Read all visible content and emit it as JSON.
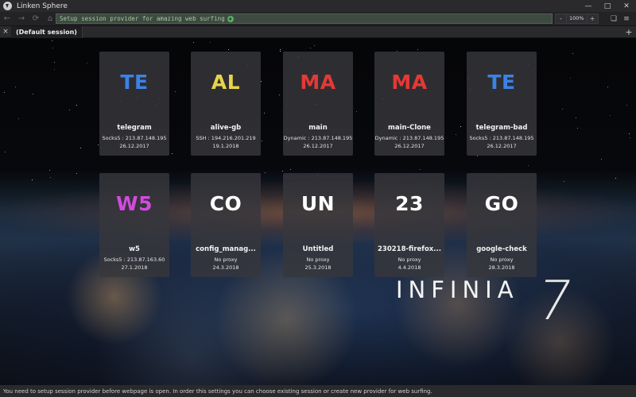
{
  "window": {
    "title": "Linken Sphere",
    "icon": "linken-sphere-logo-icon",
    "controls": [
      "minimize-icon",
      "maximize-icon",
      "close-icon"
    ]
  },
  "toolbar": {
    "back_icon": "arrow-left-icon",
    "forward_icon": "arrow-right-icon",
    "reload_icon": "reload-icon",
    "home_icon": "home-icon",
    "address_text": "Setup session provider for amazing web surfing",
    "address_plus": "+",
    "zoom": {
      "minus": "-",
      "value": "100%",
      "plus": "+"
    },
    "right_icons": [
      "bookmark-icon",
      "menu-icon"
    ]
  },
  "tabs": {
    "close_label": "×",
    "items": [
      {
        "label": "(Default session)"
      }
    ],
    "new_tab_label": "+"
  },
  "sessions": [
    {
      "abbr": "TE",
      "color": "#3b82e6",
      "name": "telegram",
      "proxy": "Socks5 : 213.87.148.195",
      "date": "26.12.2017"
    },
    {
      "abbr": "AL",
      "color": "#e7d44a",
      "name": "alive-gb",
      "proxy": "SSH : 194.216.201.219",
      "date": "19.1.2018"
    },
    {
      "abbr": "MA",
      "color": "#e53935",
      "name": "main",
      "proxy": "Dynamic : 213.87.148.195",
      "date": "26.12.2017"
    },
    {
      "abbr": "MA",
      "color": "#e53935",
      "name": "main-Clone",
      "proxy": "Dynamic : 213.87.148.195",
      "date": "26.12.2017"
    },
    {
      "abbr": "TE",
      "color": "#3b82e6",
      "name": "telegram-bad",
      "proxy": "Socks5 : 213.87.148.195",
      "date": "26.12.2017"
    },
    {
      "abbr": "W5",
      "color": "#d24ae0",
      "name": "w5",
      "proxy": "Socks5 : 213.87.163.60",
      "date": "27.1.2018"
    },
    {
      "abbr": "CO",
      "color": "#ffffff",
      "name": "config_manag...",
      "proxy": "No proxy",
      "date": "24.3.2018"
    },
    {
      "abbr": "UN",
      "color": "#ffffff",
      "name": "Untitled",
      "proxy": "No proxy",
      "date": "25.3.2018"
    },
    {
      "abbr": "23",
      "color": "#ffffff",
      "name": "230218-firefox...",
      "proxy": "No proxy",
      "date": "4.4.2018"
    },
    {
      "abbr": "GO",
      "color": "#ffffff",
      "name": "google-check",
      "proxy": "No proxy",
      "date": "28.3.2018"
    }
  ],
  "brand": {
    "text": "INFINIA",
    "number": "7"
  },
  "status": {
    "text": "You need to setup session provider before webpage is open. In order this settings you can choose existing session or create new provider for web surfing."
  }
}
